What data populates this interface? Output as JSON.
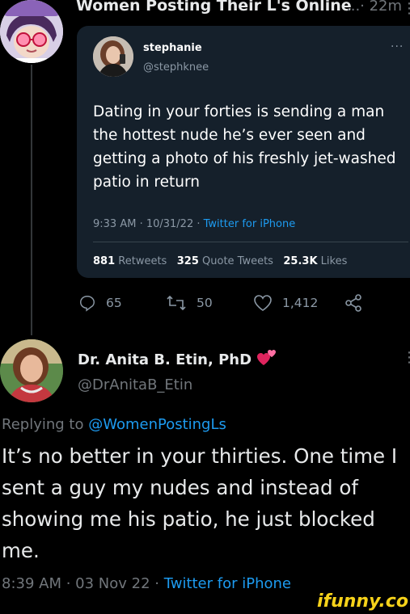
{
  "top_tweet": {
    "author_name": "Women Posting Their L's Online",
    "time": "...· 22m",
    "avatar_icon": "cartoon-avatar-icon",
    "more_icon": "more-icon"
  },
  "quoted_tweet": {
    "name": "stephanie",
    "handle": "@stephknee",
    "more": "···",
    "text": "Dating in your forties is sending a man the hottest nude he’s ever seen and getting a photo of his freshly jet-washed patio in return",
    "time": "9:33 AM · 10/31/22 · ",
    "source": "Twitter for iPhone",
    "stats": {
      "retweets_count": "881",
      "retweets_label": "Retweets",
      "quotes_count": "325",
      "quotes_label": "Quote Tweets",
      "likes_count": "25.3K",
      "likes_label": "Likes"
    }
  },
  "actions": {
    "reply_count": "65",
    "retweet_count": "50",
    "like_count": "1,412"
  },
  "reply_tweet": {
    "name": "Dr. Anita B. Etin, PhD",
    "badge_icon": "two-hearts-icon",
    "handle": "@DrAnitaB_Etin",
    "replying_prefix": "Replying to ",
    "replying_handle": "@WomenPostingLs",
    "text": "It’s no better in your thirties. One time I sent a guy my nudes and instead of showing me his patio, he just blocked me.",
    "time": "8:39 AM · 03 Nov 22 · ",
    "source": "Twitter for iPhone"
  },
  "watermark": "ifunny.co",
  "colors": {
    "background": "#000000",
    "card": "#15202b",
    "accent": "#1d9bf0",
    "muted": "#71767b",
    "heart": "#e0245e",
    "watermark": "#f6d21a"
  }
}
